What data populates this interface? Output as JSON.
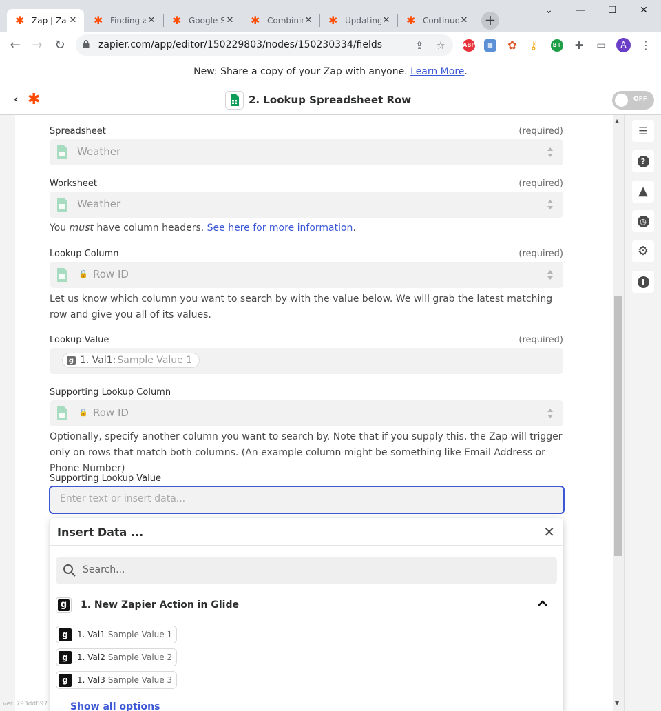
{
  "browser": {
    "tabs": [
      {
        "title": "Zap | Zapier",
        "active": true
      },
      {
        "title": "Finding a...",
        "active": false
      },
      {
        "title": "Google S...",
        "active": false
      },
      {
        "title": "Combinin...",
        "active": false
      },
      {
        "title": "Updating...",
        "active": false
      },
      {
        "title": "Continuo...",
        "active": false
      }
    ],
    "url": "zapier.com/app/editor/150229803/nodes/150230334/fields",
    "profile_initial": "A",
    "extensions": [
      "ABP",
      "B+"
    ]
  },
  "announcement": {
    "text": "New: Share a copy of your Zap with anyone.",
    "link": "Learn More",
    "suffix": "."
  },
  "header": {
    "title": "2. Lookup Spreadsheet Row",
    "toggle_label": "OFF"
  },
  "form": {
    "required_text": "(required)",
    "spreadsheet": {
      "label": "Spreadsheet",
      "value": "Weather"
    },
    "worksheet": {
      "label": "Worksheet",
      "value": "Weather"
    },
    "column_help": {
      "prefix": "You ",
      "emphasis": "must",
      "middle": " have column headers. ",
      "link": "See here for more information",
      "suffix": "."
    },
    "lookup_column": {
      "label": "Lookup Column",
      "value": "Row ID",
      "help": "Let us know which column you want to search by with the value below. We will grab the latest matching row and give you all of its values."
    },
    "lookup_value": {
      "label": "Lookup Value",
      "pill_icon": "g",
      "pill_key": "1. Val1:",
      "pill_value": "Sample Value 1"
    },
    "supporting_column": {
      "label": "Supporting Lookup Column",
      "value": "Row ID",
      "help": "Optionally, specify another column you want to search by. Note that if you supply this, the Zap will trigger only on rows that match both columns. (An example column might be something like Email Address or Phone Number)"
    },
    "supporting_value": {
      "label": "Supporting Lookup Value",
      "placeholder": "Enter text or insert data..."
    }
  },
  "insert_data": {
    "title": "Insert Data ...",
    "search_placeholder": "Search...",
    "app_icon": "g",
    "app_name": "1. New Zapier Action in Glide",
    "options": [
      {
        "key": "1. Val1",
        "value": "Sample Value 1"
      },
      {
        "key": "1. Val2",
        "value": "Sample Value 2"
      },
      {
        "key": "1. Val3",
        "value": "Sample Value 3"
      }
    ],
    "show_all": "Show all options"
  },
  "footer": {
    "version": "ver. 793dd897"
  },
  "colors": {
    "brand_orange": "#ff4a00",
    "link_blue": "#3b57d6",
    "sheets_green": "#0f9d58"
  }
}
